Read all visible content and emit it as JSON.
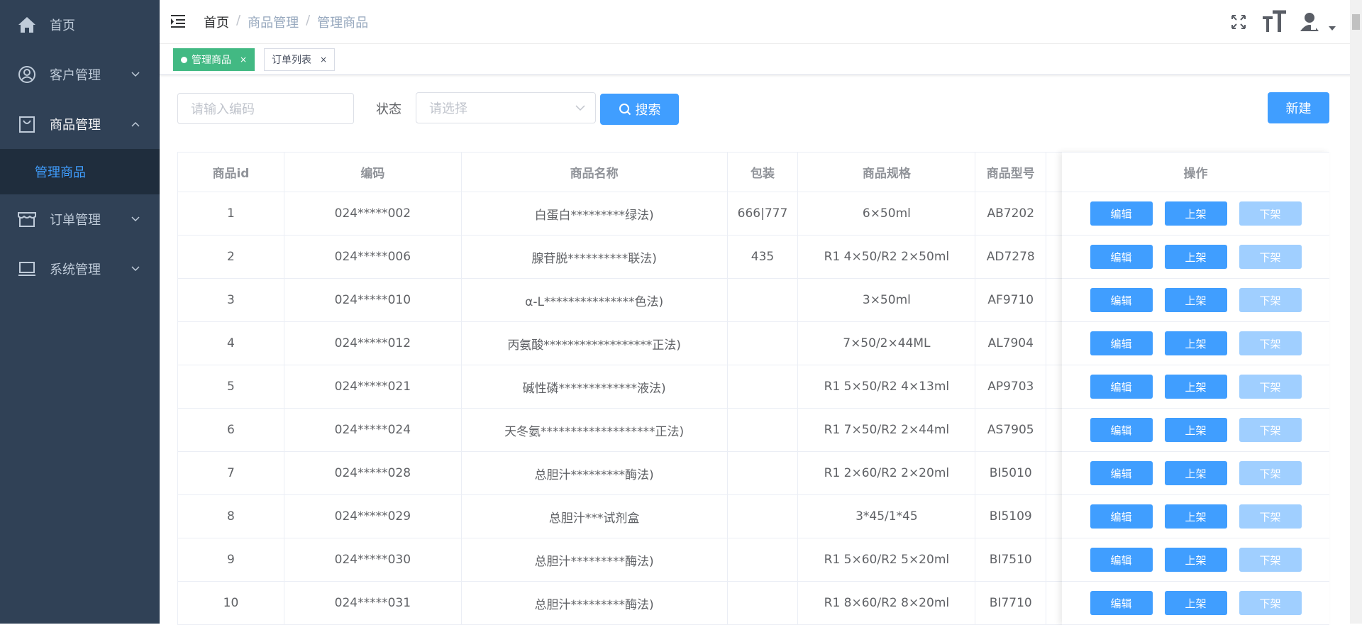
{
  "sidebar": {
    "items": [
      {
        "label": "首页",
        "icon": "home-icon"
      },
      {
        "label": "客户管理",
        "icon": "user-circle-icon"
      },
      {
        "label": "商品管理",
        "icon": "shopping-bag-icon"
      },
      {
        "label": "订单管理",
        "icon": "store-icon"
      },
      {
        "label": "系统管理",
        "icon": "monitor-icon"
      }
    ],
    "submenu": {
      "label": "管理商品"
    }
  },
  "breadcrumb": {
    "items": [
      "首页",
      "商品管理",
      "管理商品"
    ],
    "separator": "/"
  },
  "tags": [
    {
      "label": "管理商品",
      "close": "×"
    },
    {
      "label": "订单列表",
      "close": "×"
    }
  ],
  "filter": {
    "code_placeholder": "请输入编码",
    "status_label": "状态",
    "status_placeholder": "请选择",
    "search_label": "搜索",
    "new_label": "新建"
  },
  "table": {
    "columns": [
      "商品id",
      "编码",
      "商品名称",
      "包装",
      "商品规格",
      "商品型号",
      "操作"
    ],
    "rows": [
      [
        "1",
        "024*****002",
        "白蛋白*********绿法)",
        "666|777",
        "6×50ml",
        "AB7202"
      ],
      [
        "2",
        "024*****006",
        "腺苷脱**********联法)",
        "435",
        "R1 4×50/R2 2×50ml",
        "AD7278"
      ],
      [
        "3",
        "024*****010",
        "α-L***************色法)",
        "",
        "3×50ml",
        "AF9710"
      ],
      [
        "4",
        "024*****012",
        "丙氨酸******************正法)",
        "",
        "7×50/2×44ML",
        "AL7904"
      ],
      [
        "5",
        "024*****021",
        "碱性磷*************液法)",
        "",
        "R1 5×50/R2 4×13ml",
        "AP9703"
      ],
      [
        "6",
        "024*****024",
        "天冬氨*******************正法)",
        "",
        "R1 7×50/R2 2×44ml",
        "AS7905"
      ],
      [
        "7",
        "024*****028",
        "总胆汁*********酶法)",
        "",
        "R1 2×60/R2 2×20ml",
        "BI5010"
      ],
      [
        "8",
        "024*****029",
        "总胆汁***试剂盒",
        "",
        "3*45/1*45",
        "BI5109"
      ],
      [
        "9",
        "024*****030",
        "总胆汁*********酶法)",
        "",
        "R1 5×60/R2 5×20ml",
        "BI7510"
      ],
      [
        "10",
        "024*****031",
        "总胆汁*********酶法)",
        "",
        "R1 8×60/R2 8×20ml",
        "BI7710"
      ]
    ],
    "actions": {
      "edit": "编辑",
      "up": "上架",
      "down": "下架"
    }
  },
  "colors": {
    "sidebar": "#304156",
    "primary": "#409eff",
    "tag_active": "#42b983",
    "disabled": "#a0cfff"
  }
}
